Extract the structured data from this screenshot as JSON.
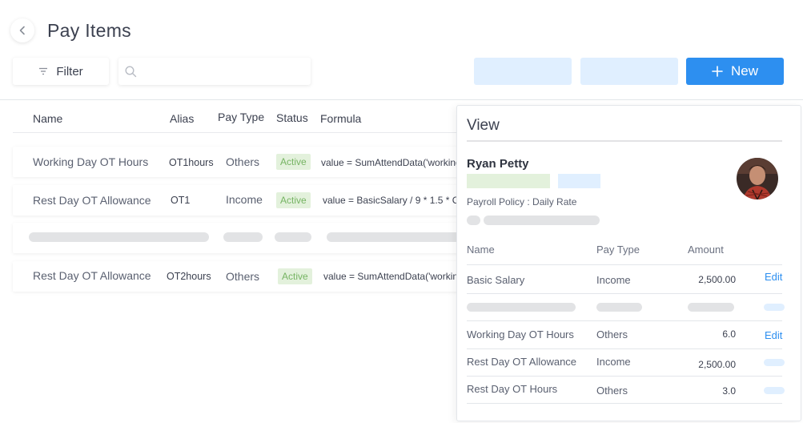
{
  "header": {
    "title": "Pay Items"
  },
  "toolbar": {
    "filter_label": "Filter",
    "search_placeholder": "",
    "new_label": "New"
  },
  "table": {
    "columns": [
      "Name",
      "Alias",
      "Pay Type",
      "Status",
      "Formula"
    ],
    "rows": [
      {
        "name": "Working Day OT Hours",
        "alias": "OT1hours",
        "pay_type": "Others",
        "status": "Active",
        "formula": "value = SumAttendData('working"
      },
      {
        "name": "Rest Day OT Allowance",
        "alias": "OT1",
        "pay_type": "Income",
        "status": "Active",
        "formula": "value =  BasicSalary / 9 * 1.5 * C"
      },
      {
        "name": "Rest Day OT Allowance",
        "alias": "OT2hours",
        "pay_type": "Others",
        "status": "Active",
        "formula": "value = SumAttendData('workin"
      }
    ]
  },
  "view": {
    "title": "View",
    "employee_name": "Ryan Petty",
    "policy": "Payroll Policy : Daily Rate",
    "columns": [
      "Name",
      "Pay Type",
      "Amount"
    ],
    "rows": [
      {
        "name": "Basic Salary",
        "pay_type": "Income",
        "amount": "2,500.00",
        "action": "Edit"
      },
      {
        "name": "Working Day OT Hours",
        "pay_type": "Others",
        "amount": "6.0",
        "action": "Edit"
      },
      {
        "name": "Rest Day OT Allowance",
        "pay_type": "Income",
        "amount": "2,500.00"
      },
      {
        "name": "Rest Day OT Hours",
        "pay_type": "Others",
        "amount": "3.0"
      }
    ]
  },
  "colors": {
    "primary": "#2d8ff0",
    "placeholder_blue": "#e0efff",
    "active_badge_bg": "#e3f1dc",
    "active_badge_text": "#76b463",
    "skeleton": "#e2e3e5"
  }
}
